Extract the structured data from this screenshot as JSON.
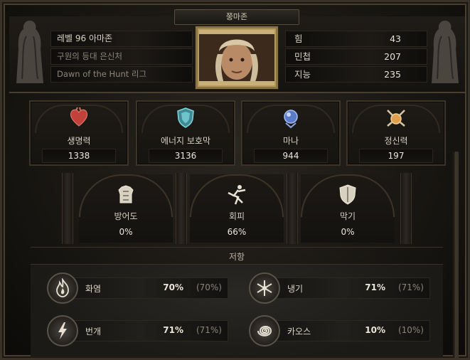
{
  "header": {
    "title": "쭝마존",
    "info": [
      {
        "text": "레벨 96 아마존"
      },
      {
        "text": "구원의 등대 은신처"
      },
      {
        "text": "Dawn of the Hunt 리그"
      }
    ],
    "attributes": [
      {
        "label": "힘",
        "value": "43"
      },
      {
        "label": "민첩",
        "value": "207"
      },
      {
        "label": "지능",
        "value": "235"
      }
    ]
  },
  "resources": [
    {
      "label": "생명력",
      "value": "1338",
      "icon": "heart-icon",
      "color": "#c2413a"
    },
    {
      "label": "에너지 보호막",
      "value": "3136",
      "icon": "shield-icon",
      "color": "#5fb6c2"
    },
    {
      "label": "마나",
      "value": "944",
      "icon": "mana-orb-icon",
      "color": "#6a8ed0"
    },
    {
      "label": "정신력",
      "value": "197",
      "icon": "spirit-icon",
      "color": "#e0a050"
    }
  ],
  "defenses": [
    {
      "label": "방어도",
      "value": "0%",
      "icon": "armour-icon"
    },
    {
      "label": "회피",
      "value": "66%",
      "icon": "evasion-icon"
    },
    {
      "label": "막기",
      "value": "0%",
      "icon": "block-shield-icon"
    }
  ],
  "resistance": {
    "title": "저항",
    "items": [
      {
        "label": "화염",
        "value": "70%",
        "max": "(70%)",
        "icon": "fire-icon"
      },
      {
        "label": "냉기",
        "value": "71%",
        "max": "(71%)",
        "icon": "cold-icon"
      },
      {
        "label": "번개",
        "value": "71%",
        "max": "(71%)",
        "icon": "lightning-icon"
      },
      {
        "label": "카오스",
        "value": "10%",
        "max": "(10%)",
        "icon": "chaos-icon"
      }
    ]
  }
}
